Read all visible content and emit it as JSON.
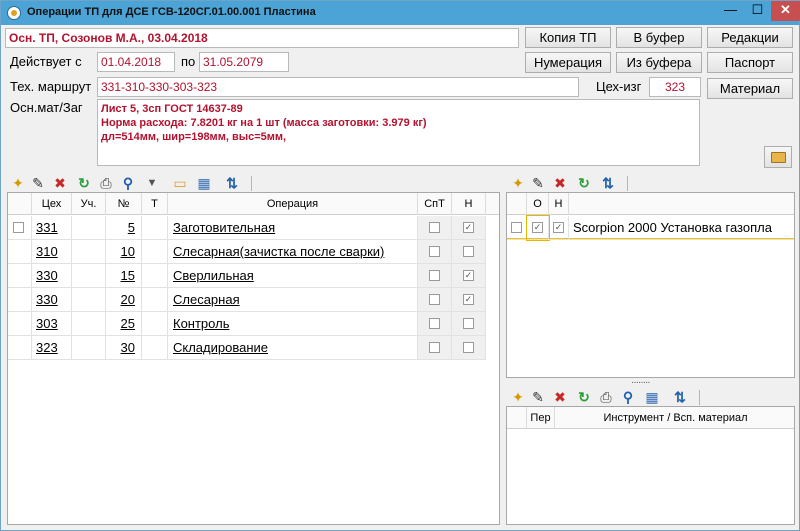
{
  "window": {
    "title": "Операции ТП для ДСЕ ГСВ-120СГ.01.00.001 Пластина",
    "minimize": "—",
    "maximize": "☐",
    "close": "✕"
  },
  "header": {
    "main_tp": "Осн. ТП, Созонов М.А., 03.04.2018",
    "valid_from_label": "Действует с",
    "valid_from": "01.04.2018",
    "valid_to_label": "по",
    "valid_to": "31.05.2079",
    "route_label": "Тех. маршрут",
    "route": "331-310-330-303-323",
    "shop_maker_label": "Цех-изг",
    "shop_maker": "323",
    "material_label": "Осн.мат/Заг",
    "material_lines": [
      "Лист 5, 3сп ГОСТ 14637-89",
      "Норма расхода: 7.8201 кг на 1 шт  (масса заготовки: 3.979 кг)",
      "дл=514мм, шир=198мм, выс=5мм,"
    ]
  },
  "buttons": {
    "copy_tp": "Копия ТП",
    "to_buffer": "В буфер",
    "edits": "Редакции",
    "numbering": "Нумерация",
    "from_buffer": "Из буфера",
    "passport": "Паспорт",
    "material": "Материал"
  },
  "operations_grid": {
    "columns": [
      "Цех",
      "Уч.",
      "№",
      "Т",
      "Операция",
      "СпТ",
      "Н"
    ],
    "rows": [
      {
        "shop": "331",
        "section": "",
        "num": "5",
        "type": "",
        "operation": "Заготовительная",
        "spt": false,
        "n": true
      },
      {
        "shop": "310",
        "section": "",
        "num": "10",
        "type": "",
        "operation": "Слесарная(зачистка после сварки)",
        "spt": false,
        "n": false
      },
      {
        "shop": "330",
        "section": "",
        "num": "15",
        "type": "",
        "operation": "Сверлильная",
        "spt": false,
        "n": true
      },
      {
        "shop": "330",
        "section": "",
        "num": "20",
        "type": "",
        "operation": "Слесарная",
        "spt": false,
        "n": true
      },
      {
        "shop": "303",
        "section": "",
        "num": "25",
        "type": "",
        "operation": "Контроль",
        "spt": false,
        "n": false
      },
      {
        "shop": "323",
        "section": "",
        "num": "30",
        "type": "",
        "operation": "Складирование",
        "spt": false,
        "n": false
      }
    ]
  },
  "equipment_grid": {
    "columns": [
      "О",
      "Н"
    ],
    "rows": [
      {
        "o": true,
        "n": true,
        "name": "Scorpion 2000 Установка газопла"
      }
    ]
  },
  "tools_grid": {
    "columns": [
      "Пер",
      "Инструмент / Всп. материал"
    ]
  },
  "icons": {
    "new": "✦",
    "edit": "✎",
    "delete": "✖",
    "refresh": "↻",
    "print": "⎙",
    "find": "⚲",
    "filter": "▼",
    "folder": "▭",
    "view": "▦",
    "sort": "⇅"
  }
}
